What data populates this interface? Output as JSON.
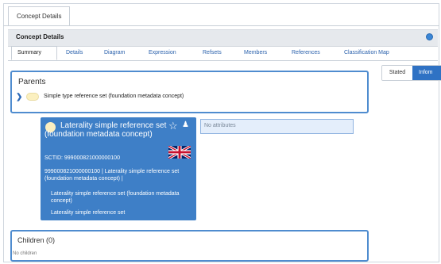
{
  "window": {
    "tab_label": "Concept Details"
  },
  "panel": {
    "title": "Concept Details",
    "info_icon": "info-dot-icon"
  },
  "tabs": [
    {
      "label": "Summary",
      "active": true
    },
    {
      "label": "Details"
    },
    {
      "label": "Diagram"
    },
    {
      "label": "Expression"
    },
    {
      "label": "Refsets"
    },
    {
      "label": "Members"
    },
    {
      "label": "References"
    },
    {
      "label": "Classification Map"
    }
  ],
  "view_toggle": {
    "stated": "Stated",
    "inferred": "Infom"
  },
  "parents": {
    "title": "Parents",
    "items": [
      {
        "label": "Simple type reference set (foundation metadata concept)"
      }
    ]
  },
  "concept": {
    "title": "Laterality simple reference set (foundation metadata concept)",
    "sctid": "SCTID: 999000821000000100",
    "fsn_line": "999000821000000100 | Laterality simple reference set (foundation metadata concept) |",
    "synonym_1": "Laterality simple reference set (foundation metadata concept)",
    "synonym_2": "Laterality simple reference set",
    "flag": "uk-flag-icon",
    "accent_color": "#3e7fc7"
  },
  "attributes": {
    "placeholder": "No attributes"
  },
  "children": {
    "title": "Children (0)",
    "empty_text": "No children"
  }
}
